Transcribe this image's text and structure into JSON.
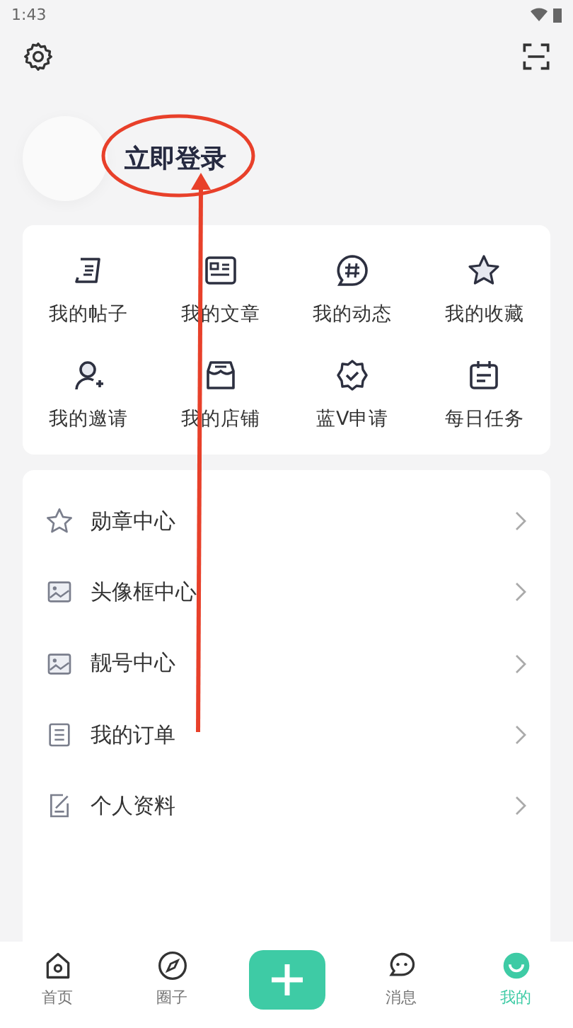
{
  "status_bar": {
    "time": "1:43"
  },
  "profile": {
    "login_text": "立即登录"
  },
  "shortcuts": [
    {
      "label": "我的帖子"
    },
    {
      "label": "我的文章"
    },
    {
      "label": "我的动态"
    },
    {
      "label": "我的收藏"
    },
    {
      "label": "我的邀请"
    },
    {
      "label": "我的店铺"
    },
    {
      "label": "蓝V申请"
    },
    {
      "label": "每日任务"
    }
  ],
  "menu": [
    {
      "label": "勋章中心"
    },
    {
      "label": "头像框中心"
    },
    {
      "label": "靓号中心"
    },
    {
      "label": "我的订单"
    },
    {
      "label": "个人资料"
    }
  ],
  "tabs": [
    {
      "label": "首页",
      "selected": false
    },
    {
      "label": "圈子",
      "selected": false
    },
    {
      "kind": "add"
    },
    {
      "label": "消息",
      "selected": false
    },
    {
      "label": "我的",
      "selected": true
    }
  ]
}
